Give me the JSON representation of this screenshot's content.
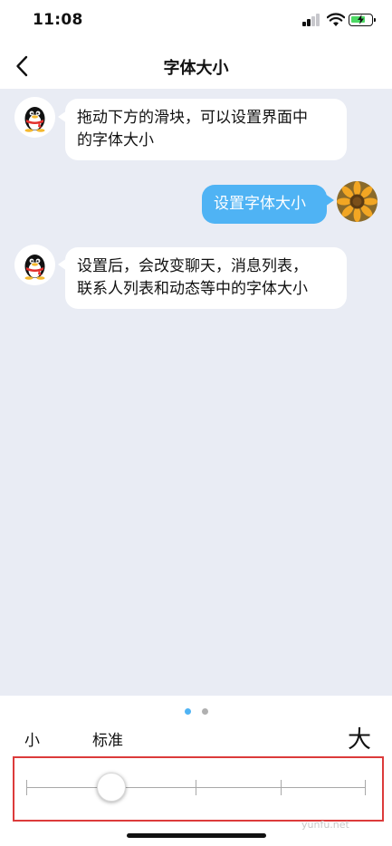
{
  "status_bar": {
    "time": "11:08"
  },
  "nav": {
    "title": "字体大小",
    "back_icon": "chevron-left-icon"
  },
  "chat": {
    "messages": [
      {
        "side": "left",
        "avatar": "qq-penguin-avatar",
        "lines": [
          "拖动下方的滑块，可以设置界面中",
          "的字体大小"
        ]
      },
      {
        "side": "right",
        "avatar": "sunflower-avatar",
        "lines": [
          "设置字体大小"
        ]
      },
      {
        "side": "left",
        "avatar": "qq-penguin-avatar",
        "lines": [
          "设置后，会改变聊天，消息列表，",
          "联系人列表和动态等中的字体大小"
        ]
      }
    ]
  },
  "font_size": {
    "label_small": "小",
    "label_standard": "标准",
    "label_large": "大",
    "levels": 5,
    "selected_level": 2,
    "page_dots": 2,
    "active_page": 1
  },
  "watermark": "yunfu.net",
  "colors": {
    "chat_bg": "#e9ecf4",
    "bubble_self": "#4fb3f4",
    "bubble_other": "#ffffff",
    "highlight_frame": "#dc3b3b",
    "dot_active": "#4fb3f4",
    "dot_inactive": "#b0b0b0"
  }
}
